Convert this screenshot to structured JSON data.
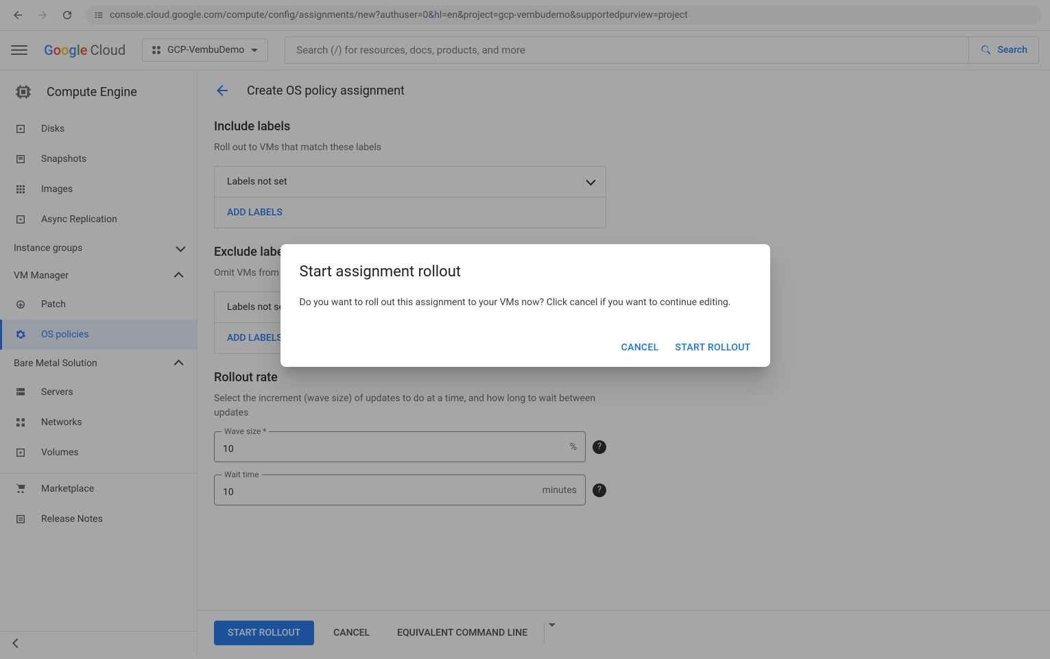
{
  "browser": {
    "url": "console.cloud.google.com/compute/config/assignments/new?authuser=0&hl=en&project=gcp-vembudemo&supportedpurview=project"
  },
  "header": {
    "logo_google": "Google",
    "logo_cloud": "Cloud",
    "project_name": "GCP-VembuDemo",
    "search_placeholder": "Search (/) for resources, docs, products, and more",
    "search_button": "Search"
  },
  "sidebar": {
    "product": "Compute Engine",
    "items": [
      {
        "label": "Disks"
      },
      {
        "label": "Snapshots"
      },
      {
        "label": "Images"
      },
      {
        "label": "Async Replication"
      }
    ],
    "groups": [
      {
        "label": "Instance groups",
        "expanded": false
      },
      {
        "label": "VM Manager",
        "expanded": true
      },
      {
        "label": "Bare Metal Solution",
        "expanded": true
      }
    ],
    "vm_manager_items": [
      {
        "label": "Patch"
      },
      {
        "label": "OS policies",
        "active": true
      }
    ],
    "bare_metal_items": [
      {
        "label": "Servers"
      },
      {
        "label": "Networks"
      },
      {
        "label": "Volumes"
      }
    ],
    "footer_items": [
      {
        "label": "Marketplace"
      },
      {
        "label": "Release Notes"
      }
    ]
  },
  "page": {
    "title": "Create OS policy assignment"
  },
  "sections": {
    "include": {
      "heading": "Include labels",
      "desc": "Roll out to VMs that match these labels",
      "not_set": "Labels not set",
      "add": "ADD LABELS"
    },
    "exclude": {
      "heading": "Exclude labels",
      "desc": "Omit VMs from the rollout if th",
      "not_set": "Labels not set",
      "add": "ADD LABELS"
    },
    "rollout": {
      "heading": "Rollout rate",
      "desc": "Select the increment (wave size) of updates to do at a time, and how long to wait between updates",
      "wave_label": "Wave size *",
      "wave_value": "10",
      "wave_suffix": "%",
      "wait_label": "Wait time",
      "wait_value": "10",
      "wait_suffix": "minutes"
    }
  },
  "actions": {
    "start": "START ROLLOUT",
    "cancel": "CANCEL",
    "cmdline": "EQUIVALENT COMMAND LINE"
  },
  "dialog": {
    "title": "Start assignment rollout",
    "body": "Do you want to roll out this assignment to your VMs now? Click cancel if you want to continue editing.",
    "cancel": "CANCEL",
    "confirm": "START ROLLOUT"
  }
}
